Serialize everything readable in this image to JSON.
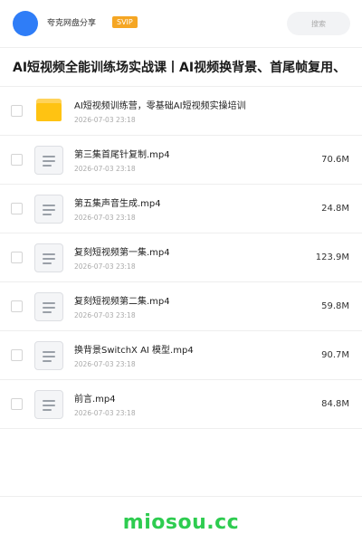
{
  "header": {
    "username": "夸克网盘分享",
    "badge": "SVIP",
    "search_placeholder": "搜索"
  },
  "title": "AI短视频全能训练场实战课丨AI视频换背景、首尾帧复用、",
  "files": [
    {
      "type": "folder",
      "name": "AI短视频训练营，零基础AI短视频实操培训",
      "date": "2026-07-03 23:18",
      "size": ""
    },
    {
      "type": "file",
      "name": "第三集首尾针复制.mp4",
      "date": "2026-07-03 23:18",
      "size": "70.6M"
    },
    {
      "type": "file",
      "name": "第五集声音生成.mp4",
      "date": "2026-07-03 23:18",
      "size": "24.8M"
    },
    {
      "type": "file",
      "name": "复刻短视频第一集.mp4",
      "date": "2026-07-03 23:18",
      "size": "123.9M"
    },
    {
      "type": "file",
      "name": "复刻短视频第二集.mp4",
      "date": "2026-07-03 23:18",
      "size": "59.8M"
    },
    {
      "type": "file",
      "name": "换背景SwitchX AI 模型.mp4",
      "date": "2026-07-03 23:18",
      "size": "90.7M"
    },
    {
      "type": "file",
      "name": "前言.mp4",
      "date": "2026-07-03 23:18",
      "size": "84.8M"
    }
  ],
  "watermark": "miosou.cc",
  "colors": {
    "avatar": "#2f7df7",
    "badge": "#f5a623",
    "folder": "#ffc312",
    "watermark": "#2ecc50"
  }
}
